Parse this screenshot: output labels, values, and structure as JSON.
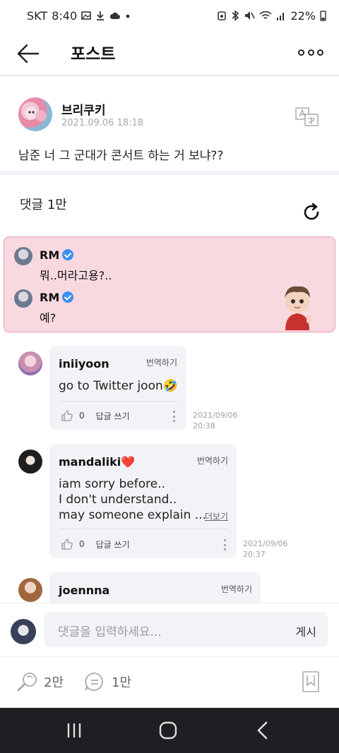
{
  "status_bar": {
    "carrier": "SKT",
    "time": "8:40",
    "battery": "22%"
  },
  "header": {
    "title": "포스트"
  },
  "post": {
    "author": "브리쿠키",
    "date": "2021.09.06 18:18",
    "body": "남준 너 그 군대가 콘서트 하는 거 보냐??"
  },
  "comments_header": "댓글 1만",
  "artist_replies": [
    {
      "name": "RM",
      "text": "뭐..머라고용?.."
    },
    {
      "name": "RM",
      "text": "예?"
    }
  ],
  "comments": [
    {
      "user": "iniiyoon",
      "translate_label": "번역하기",
      "lines": [
        "go to Twitter joon🤣"
      ],
      "likes": "0",
      "reply_label": "답글 쓰기",
      "date": "2021/09/06",
      "time": "20:38"
    },
    {
      "user": "mandaliki❤️",
      "translate_label": "번역하기",
      "lines": [
        "iam sorry before..",
        "I don't understand..",
        "may someone explain ..."
      ],
      "more_label": "더보기",
      "likes": "0",
      "reply_label": "답글 쓰기",
      "date": "2021/09/06",
      "time": "20:37"
    },
    {
      "user": "joennna",
      "translate_label": "번역하기"
    }
  ],
  "composer": {
    "placeholder": "댓글을 입력하세요...",
    "post_label": "게시"
  },
  "bottom_bar": {
    "likes": "2만",
    "comments": "1만"
  },
  "colors": {
    "artist_bg": "#f8d9e0",
    "artist_border": "#ef9fb2",
    "verified": "#3a8ff0",
    "card_bg": "#f2f3f7"
  }
}
